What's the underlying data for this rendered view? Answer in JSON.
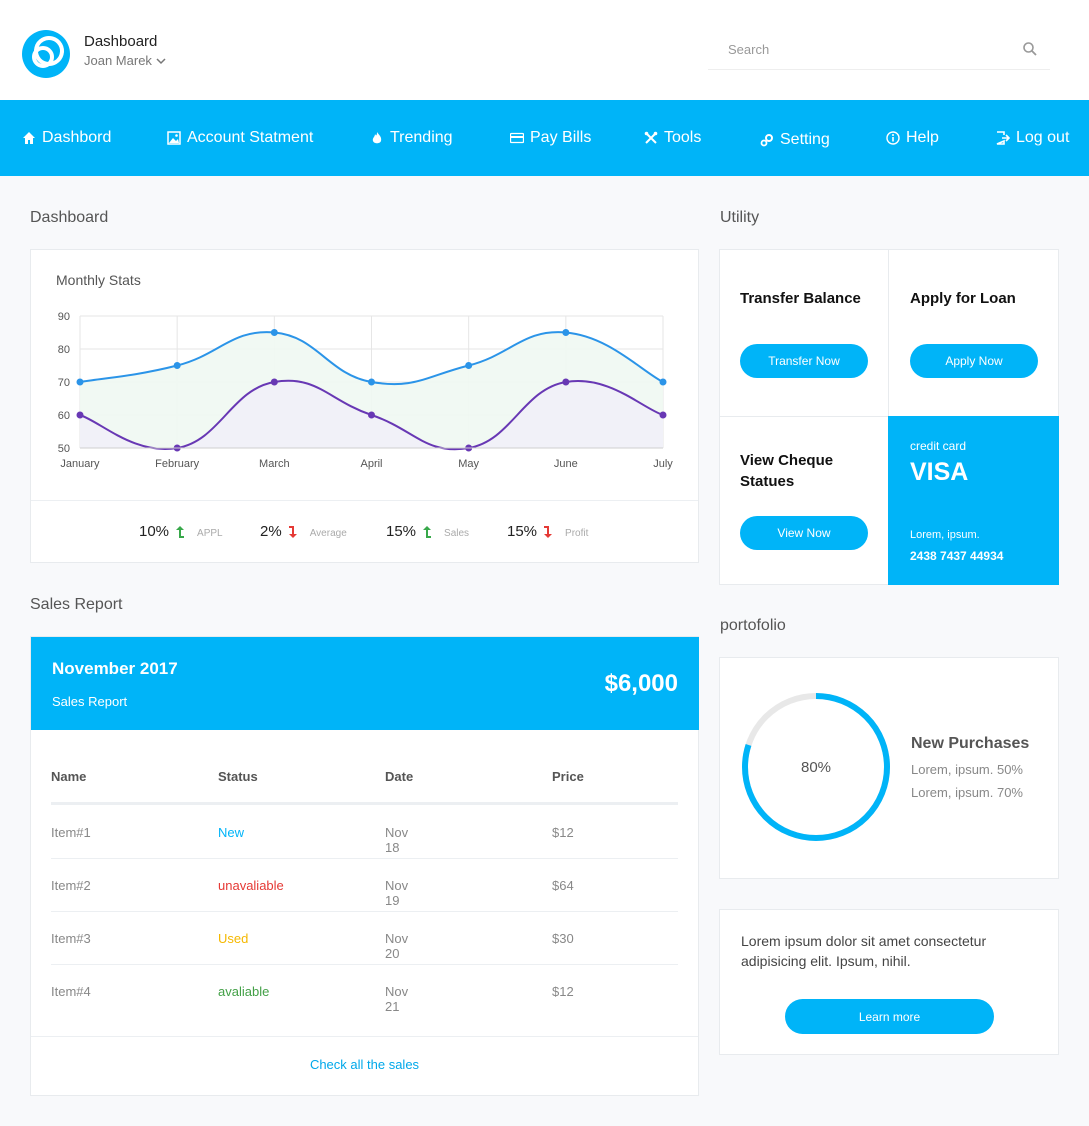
{
  "header": {
    "title": "Dashboard",
    "user": "Joan Marek",
    "search_placeholder": "Search"
  },
  "nav": [
    {
      "label": "Dashbord",
      "icon": "home-icon"
    },
    {
      "label": "Account Statment",
      "icon": "image-icon"
    },
    {
      "label": "Trending",
      "icon": "flame-icon"
    },
    {
      "label": "Pay Bills",
      "icon": "credit-card-icon"
    },
    {
      "label": "Tools",
      "icon": "tools-icon"
    },
    {
      "label": "Setting",
      "icon": "gears-icon"
    },
    {
      "label": "Help",
      "icon": "info-icon"
    },
    {
      "label": "Log out",
      "icon": "logout-icon"
    }
  ],
  "colors": {
    "accent": "#00b4f8",
    "series1": "#2b94e8",
    "series2": "#6838b4",
    "up": "#38a84a",
    "down": "#e53935",
    "used": "#f5b800",
    "available": "#43a047"
  },
  "dashboard": {
    "section_title": "Dashboard",
    "stats_title": "Monthly Stats",
    "stats": [
      {
        "value": "10%",
        "dir": "up",
        "label": "APPL"
      },
      {
        "value": "2%",
        "dir": "down",
        "label": "Average"
      },
      {
        "value": "15%",
        "dir": "up",
        "label": "Sales"
      },
      {
        "value": "15%",
        "dir": "down",
        "label": "Profit"
      }
    ]
  },
  "chart_data": {
    "type": "area",
    "x": [
      "January",
      "February",
      "March",
      "April",
      "May",
      "June",
      "July"
    ],
    "yticks": [
      50,
      60,
      70,
      80,
      90
    ],
    "ylim": [
      50,
      90
    ],
    "grid": true,
    "series": [
      {
        "values": [
          70,
          75,
          85,
          70,
          75,
          85,
          70
        ],
        "color": "#2b94e8",
        "fill": "#f0f8f2"
      },
      {
        "values": [
          60,
          50,
          70,
          60,
          50,
          70,
          60
        ],
        "color": "#6838b4",
        "fill": "#f1eff8"
      }
    ]
  },
  "utility": {
    "section_title": "Utility",
    "transfer": {
      "title": "Transfer Balance",
      "button": "Transfer Now"
    },
    "loan": {
      "title": "Apply for Loan",
      "button": "Apply Now"
    },
    "cheque": {
      "title": "View Cheque Statues",
      "button": "View Now"
    },
    "card": {
      "label": "credit card",
      "brand": "VISA",
      "holder": "Lorem, ipsum.",
      "number": "2438 7437 44934"
    }
  },
  "sales": {
    "section_title": "Sales Report",
    "period": "November 2017",
    "subtitle": "Sales Report",
    "total": "$6,000",
    "columns": [
      "Name",
      "Status",
      "Date",
      "Price"
    ],
    "rows": [
      {
        "name": "Item#1",
        "status": "New",
        "status_color": "#00b4f8",
        "date": "Nov 18",
        "price": "$12"
      },
      {
        "name": "Item#2",
        "status": "unavaliable",
        "status_color": "#e53935",
        "date": "Nov 19",
        "price": "$64"
      },
      {
        "name": "Item#3",
        "status": "Used",
        "status_color": "#f5b800",
        "date": "Nov 20",
        "price": "$30"
      },
      {
        "name": "Item#4",
        "status": "avaliable",
        "status_color": "#43a047",
        "date": "Nov 21",
        "price": "$12"
      }
    ],
    "footer_link": "Check all the sales"
  },
  "portfolio": {
    "section_title": "portofolio",
    "percent": 80,
    "percent_label": "80%",
    "title": "New Purchases",
    "lines": [
      "Lorem, ipsum. 50%",
      "Lorem, ipsum. 70%"
    ]
  },
  "promo": {
    "text": "Lorem ipsum dolor sit amet consectetur adipisicing elit. Ipsum, nihil.",
    "button": "Learn more"
  }
}
